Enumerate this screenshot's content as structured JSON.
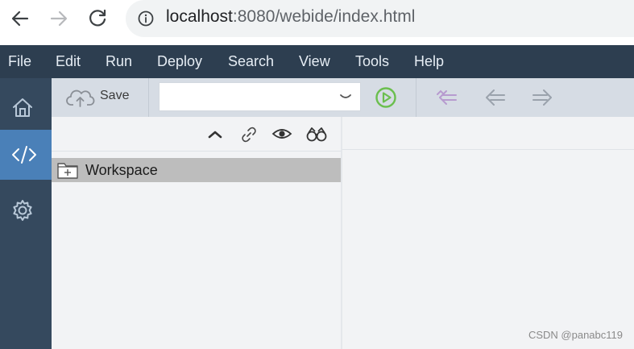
{
  "browser": {
    "url_host": "localhost",
    "url_rest": ":8080/webide/index.html"
  },
  "menu": {
    "items": [
      "File",
      "Edit",
      "Run",
      "Deploy",
      "Search",
      "View",
      "Tools",
      "Help"
    ]
  },
  "rail": {
    "items": [
      {
        "icon": "home-icon",
        "active": false
      },
      {
        "icon": "code-icon",
        "active": true
      },
      {
        "icon": "gear-icon",
        "active": false
      }
    ]
  },
  "toolbar": {
    "save_label": "Save",
    "select_value": "",
    "run_color": "#6bbf4e"
  },
  "explorer": {
    "root_label": "Workspace"
  },
  "watermark": "CSDN @panabc119",
  "colors": {
    "menubar": "#2d3e50",
    "rail": "#35495e",
    "rail_active": "#4a80b8",
    "toolbar": "#d6dce4"
  }
}
